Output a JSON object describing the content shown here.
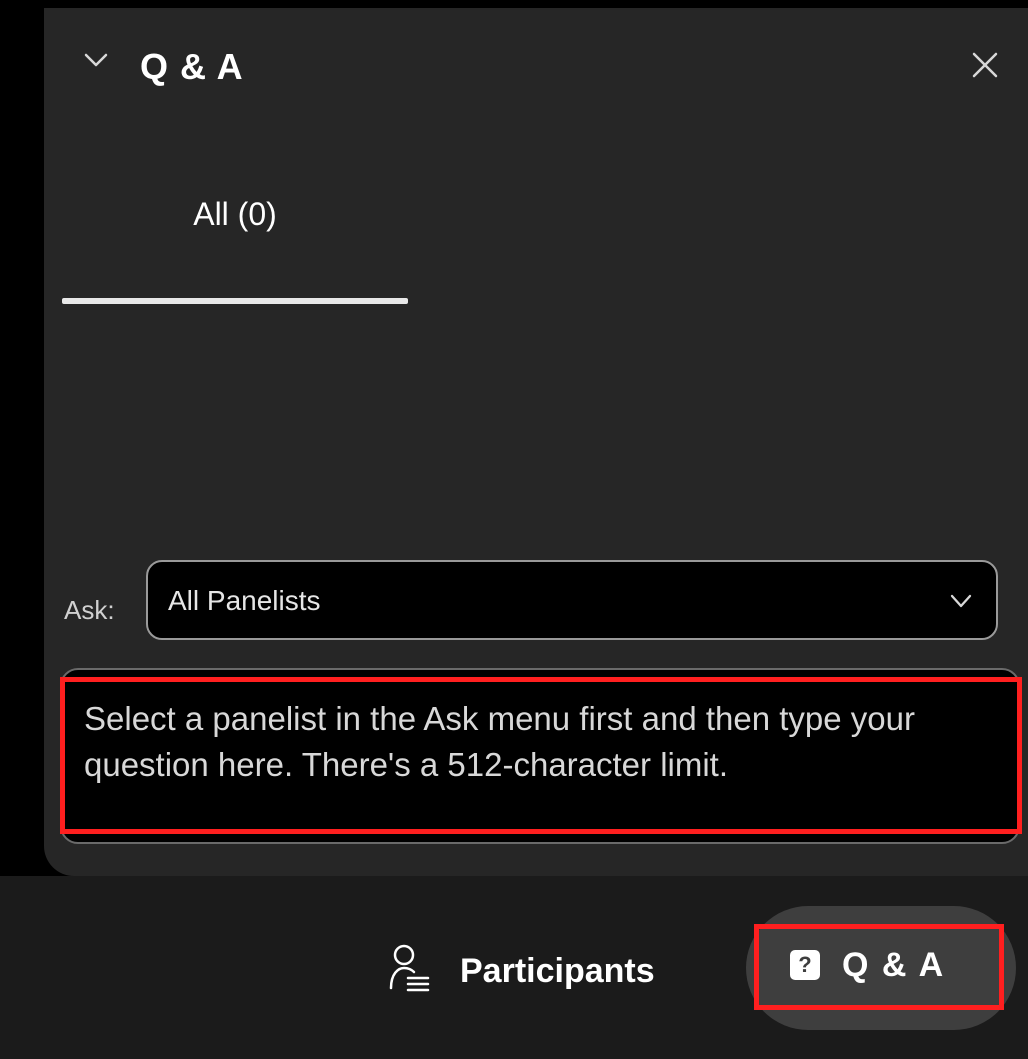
{
  "panel": {
    "title": "Q & A",
    "collapse_icon": "chevron-down-icon",
    "close_icon": "close-icon"
  },
  "tabs": [
    {
      "label": "All (0)",
      "active": true
    }
  ],
  "ask": {
    "label": "Ask:",
    "selected": "All Panelists",
    "dropdown_icon": "chevron-down-icon"
  },
  "question": {
    "value": "",
    "placeholder": "Select a panelist in the Ask menu first and then type your question here. There's a 512-character limit."
  },
  "bottom_bar": {
    "participants_label": "Participants",
    "participants_icon": "participants-icon",
    "qa_label": "Q & A",
    "qa_icon_glyph": "?",
    "qa_icon": "question-icon"
  },
  "colors": {
    "panel_bg": "#262626",
    "page_bg": "#000000",
    "bottom_bar_bg": "#1b1b1b",
    "active_pill_bg": "#3e3e3e",
    "highlight": "#ff1f1f",
    "text": "#ffffff"
  }
}
